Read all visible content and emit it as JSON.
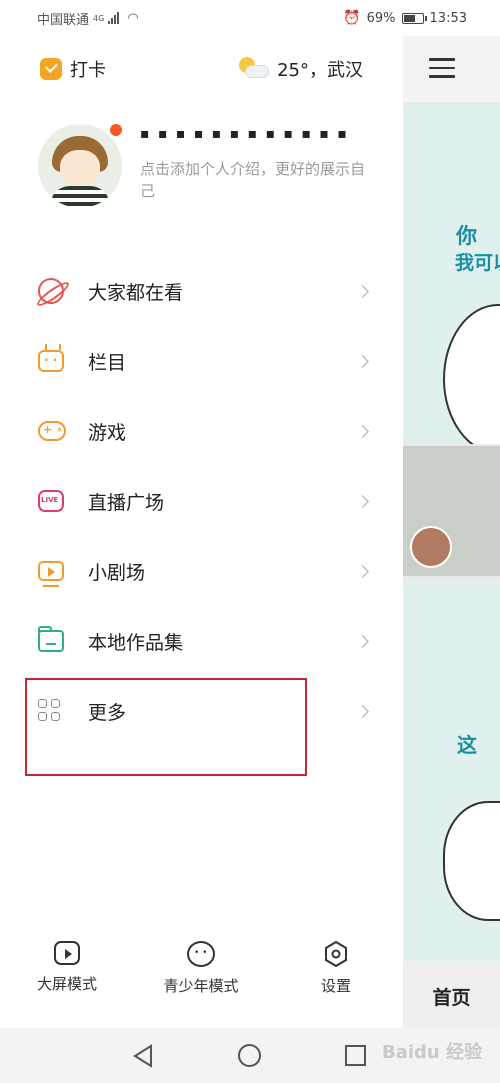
{
  "status_bar": {
    "carrier": "中国联通",
    "network": "4G",
    "alarm_icon": "alarm-icon",
    "battery_percent": "69%",
    "battery_level": 0.69,
    "time": "13:53"
  },
  "drawer": {
    "checkin_label": "打卡",
    "weather_text": "25°，武汉",
    "profile": {
      "username": "▪ ▪ ▪ ▪ ▪ ▪ ▪ ▪ ▪ ▪ ▪ ▪",
      "bio": "点击添加个人介绍，更好的展示自己"
    },
    "menu": [
      {
        "label": "大家都在看",
        "icon": "planet-icon"
      },
      {
        "label": "栏目",
        "icon": "tv-icon"
      },
      {
        "label": "游戏",
        "icon": "gamepad-icon"
      },
      {
        "label": "直播广场",
        "icon": "live-icon"
      },
      {
        "label": "小剧场",
        "icon": "play-screen-icon"
      },
      {
        "label": "本地作品集",
        "icon": "folder-icon"
      },
      {
        "label": "更多",
        "icon": "grid-icon"
      }
    ],
    "bottom": [
      {
        "label": "大屏模式",
        "icon": "big-screen-icon"
      },
      {
        "label": "青少年模式",
        "icon": "kid-face-icon"
      },
      {
        "label": "设置",
        "icon": "gear-icon"
      }
    ]
  },
  "background": {
    "banner_text_1": "你",
    "banner_text_2": "我可以",
    "banner_text_3": "这",
    "tab_home": "首页"
  },
  "nav": {
    "watermark": "Baidu 经验"
  },
  "colors": {
    "highlight_border": "#c8262c",
    "notification_dot": "#f45a23",
    "checkin_orange": "#f5a524"
  }
}
